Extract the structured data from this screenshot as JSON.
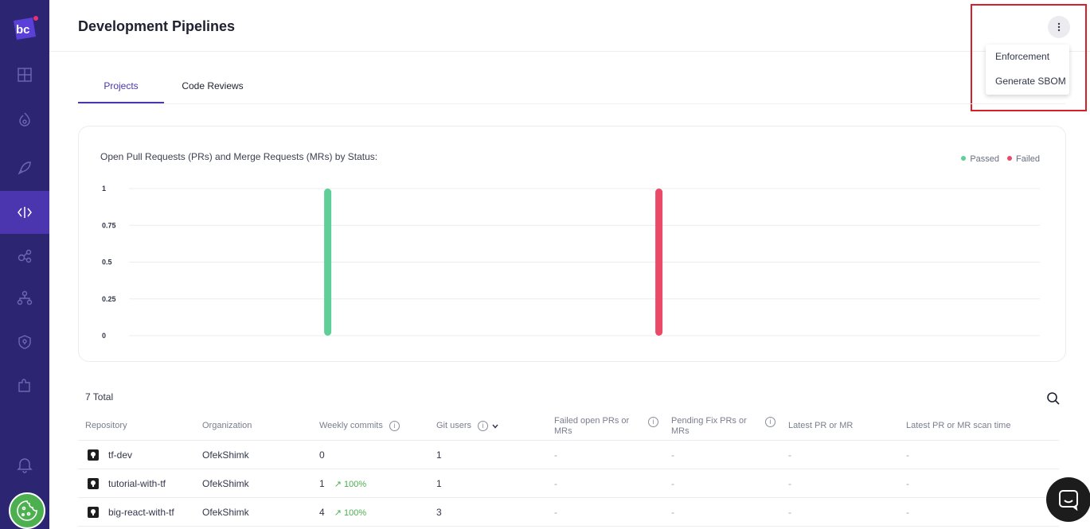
{
  "header": {
    "title": "Development Pipelines",
    "more_icon": "kebab-vertical-icon"
  },
  "menu": {
    "items": [
      {
        "label": "Enforcement"
      },
      {
        "label": "Generate SBOM"
      }
    ]
  },
  "tabs": [
    {
      "label": "Projects",
      "active": true
    },
    {
      "label": "Code Reviews",
      "active": false
    }
  ],
  "chart_data": {
    "type": "bar",
    "title": "Open Pull Requests (PRs) and Merge Requests (MRs) by Status:",
    "categories": [
      "Passed",
      "Failed"
    ],
    "series": [
      {
        "name": "Passed",
        "values": [
          1
        ],
        "color": "#5ecf96"
      },
      {
        "name": "Failed",
        "values": [
          1
        ],
        "color": "#ea4a67"
      }
    ],
    "yticks": [
      "1",
      "0.75",
      "0.5",
      "0.25",
      "0"
    ],
    "ylim": [
      0,
      1
    ],
    "legend": "top-right",
    "grid": true
  },
  "table": {
    "total_label": "7 Total",
    "columns": [
      {
        "label": "Repository",
        "info": false
      },
      {
        "label": "Organization",
        "info": false
      },
      {
        "label": "Weekly commits",
        "info": true
      },
      {
        "label": "Git users",
        "info": true,
        "sort": true
      },
      {
        "label": "Failed open PRs or MRs",
        "info": true
      },
      {
        "label": "Pending Fix PRs or MRs",
        "info": true
      },
      {
        "label": "Latest PR or MR",
        "info": false
      },
      {
        "label": "Latest PR or MR scan time",
        "info": false
      }
    ],
    "rows": [
      {
        "repo": "tf-dev",
        "org": "OfekShimk",
        "commits": "0",
        "trend": "",
        "users": "1",
        "failed": "-",
        "pending": "-",
        "latest": "-",
        "scan": "-"
      },
      {
        "repo": "tutorial-with-tf",
        "org": "OfekShimk",
        "commits": "1",
        "trend": "↗ 100%",
        "users": "1",
        "failed": "-",
        "pending": "-",
        "latest": "-",
        "scan": "-"
      },
      {
        "repo": "big-react-with-tf",
        "org": "OfekShimk",
        "commits": "4",
        "trend": "↗ 100%",
        "users": "3",
        "failed": "-",
        "pending": "-",
        "latest": "-",
        "scan": "-"
      }
    ]
  },
  "colors": {
    "sidebar": "#2b2572",
    "accent": "#4b36b0",
    "passed": "#5ecf96",
    "failed": "#ea4a67",
    "highlight": "#d61f26"
  }
}
